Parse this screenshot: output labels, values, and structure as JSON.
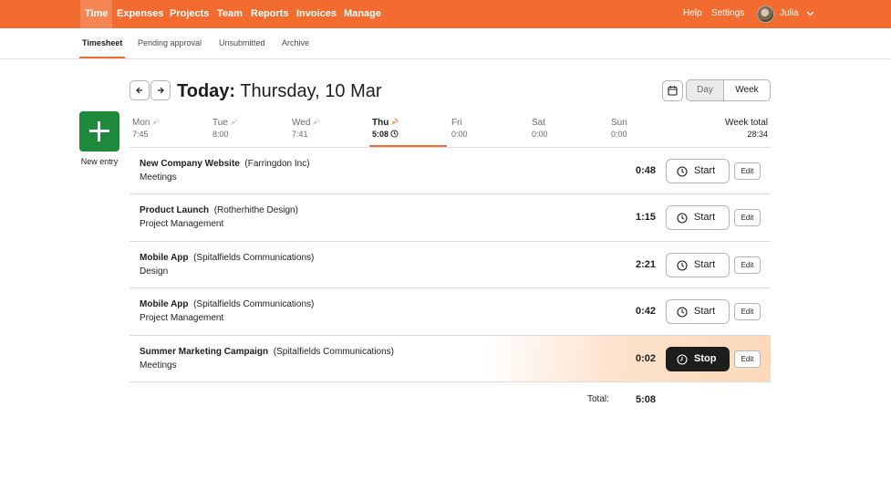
{
  "nav": {
    "items": [
      "Time",
      "Expenses",
      "Projects",
      "Team",
      "Reports",
      "Invoices",
      "Manage"
    ],
    "active": "Time",
    "help": "Help",
    "settings": "Settings",
    "user": "Julia"
  },
  "subnav": {
    "items": [
      "Timesheet",
      "Pending approval",
      "Unsubmitted",
      "Archive"
    ],
    "active": "Timesheet"
  },
  "header": {
    "title_bold": "Today:",
    "title_rest": "Thursday, 10 Mar",
    "view_day": "Day",
    "view_week": "Week"
  },
  "new_entry": {
    "label": "New entry"
  },
  "week": {
    "days": [
      {
        "name": "Mon",
        "time": "7:45"
      },
      {
        "name": "Tue",
        "time": "8:00"
      },
      {
        "name": "Wed",
        "time": "7:41"
      },
      {
        "name": "Thu",
        "time": "5:08"
      },
      {
        "name": "Fri",
        "time": "0:00"
      },
      {
        "name": "Sat",
        "time": "0:00"
      },
      {
        "name": "Sun",
        "time": "0:00"
      }
    ],
    "total_label": "Week total",
    "total_value": "28:34"
  },
  "entries": [
    {
      "project": "New Company Website",
      "client": "(Farringdon Inc)",
      "task": "Meetings",
      "time": "0:48",
      "action": "Start",
      "edit": "Edit"
    },
    {
      "project": "Product Launch",
      "client": "(Rotherhithe Design)",
      "task": "Project Management",
      "time": "1:15",
      "action": "Start",
      "edit": "Edit"
    },
    {
      "project": "Mobile App",
      "client": "(Spitalfields Communications)",
      "task": "Design",
      "time": "2:21",
      "action": "Start",
      "edit": "Edit"
    },
    {
      "project": "Mobile App",
      "client": "(Spitalfields Communications)",
      "task": "Project Management",
      "time": "0:42",
      "action": "Start",
      "edit": "Edit"
    },
    {
      "project": "Summer Marketing Campaign",
      "client": "(Spitalfields Communications)",
      "task": "Meetings",
      "time": "0:02",
      "action": "Stop",
      "edit": "Edit"
    }
  ],
  "footer": {
    "total_label": "Total:",
    "total_value": "5:08"
  },
  "colors": {
    "brand": "#f36c2f",
    "new_entry": "#1f8a3b",
    "stop": "#1d1e1c"
  }
}
